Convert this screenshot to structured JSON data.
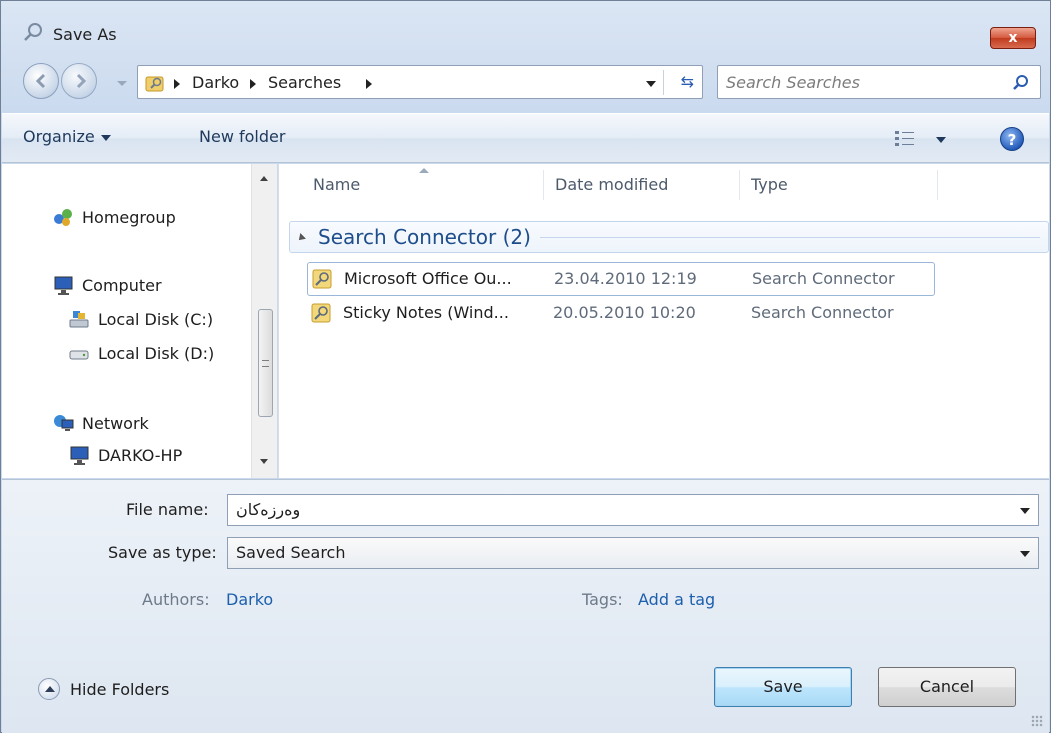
{
  "window": {
    "title": "Save As",
    "close_label": "x"
  },
  "address": {
    "crumbs": [
      "Darko",
      "Searches"
    ],
    "search_placeholder": "Search Searches"
  },
  "toolbar": {
    "organize": "Organize",
    "new_folder": "New folder",
    "help": "?"
  },
  "nav": {
    "homegroup": "Homegroup",
    "computer": "Computer",
    "local_c": "Local Disk (C:)",
    "local_d": "Local Disk (D:)",
    "network": "Network",
    "darko_hp": "DARKO-HP"
  },
  "files": {
    "columns": {
      "name": "Name",
      "date": "Date modified",
      "type": "Type"
    },
    "group": "Search Connector (2)",
    "rows": [
      {
        "name": "Microsoft Office Ou...",
        "date": "23.04.2010 12:19",
        "type": "Search Connector"
      },
      {
        "name": "Sticky Notes (Wind...",
        "date": "20.05.2010 10:20",
        "type": "Search Connector"
      }
    ]
  },
  "form": {
    "file_name_label": "File name:",
    "file_name_value": "وەرزەکان",
    "save_type_label": "Save as type:",
    "save_type_value": "Saved Search",
    "authors_label": "Authors:",
    "authors_value": "Darko",
    "tags_label": "Tags:",
    "tags_value": "Add a tag",
    "hide_folders": "Hide Folders",
    "save": "Save",
    "cancel": "Cancel"
  },
  "colors": {
    "accent": "#1c5fad",
    "close": "#c03b1f"
  }
}
